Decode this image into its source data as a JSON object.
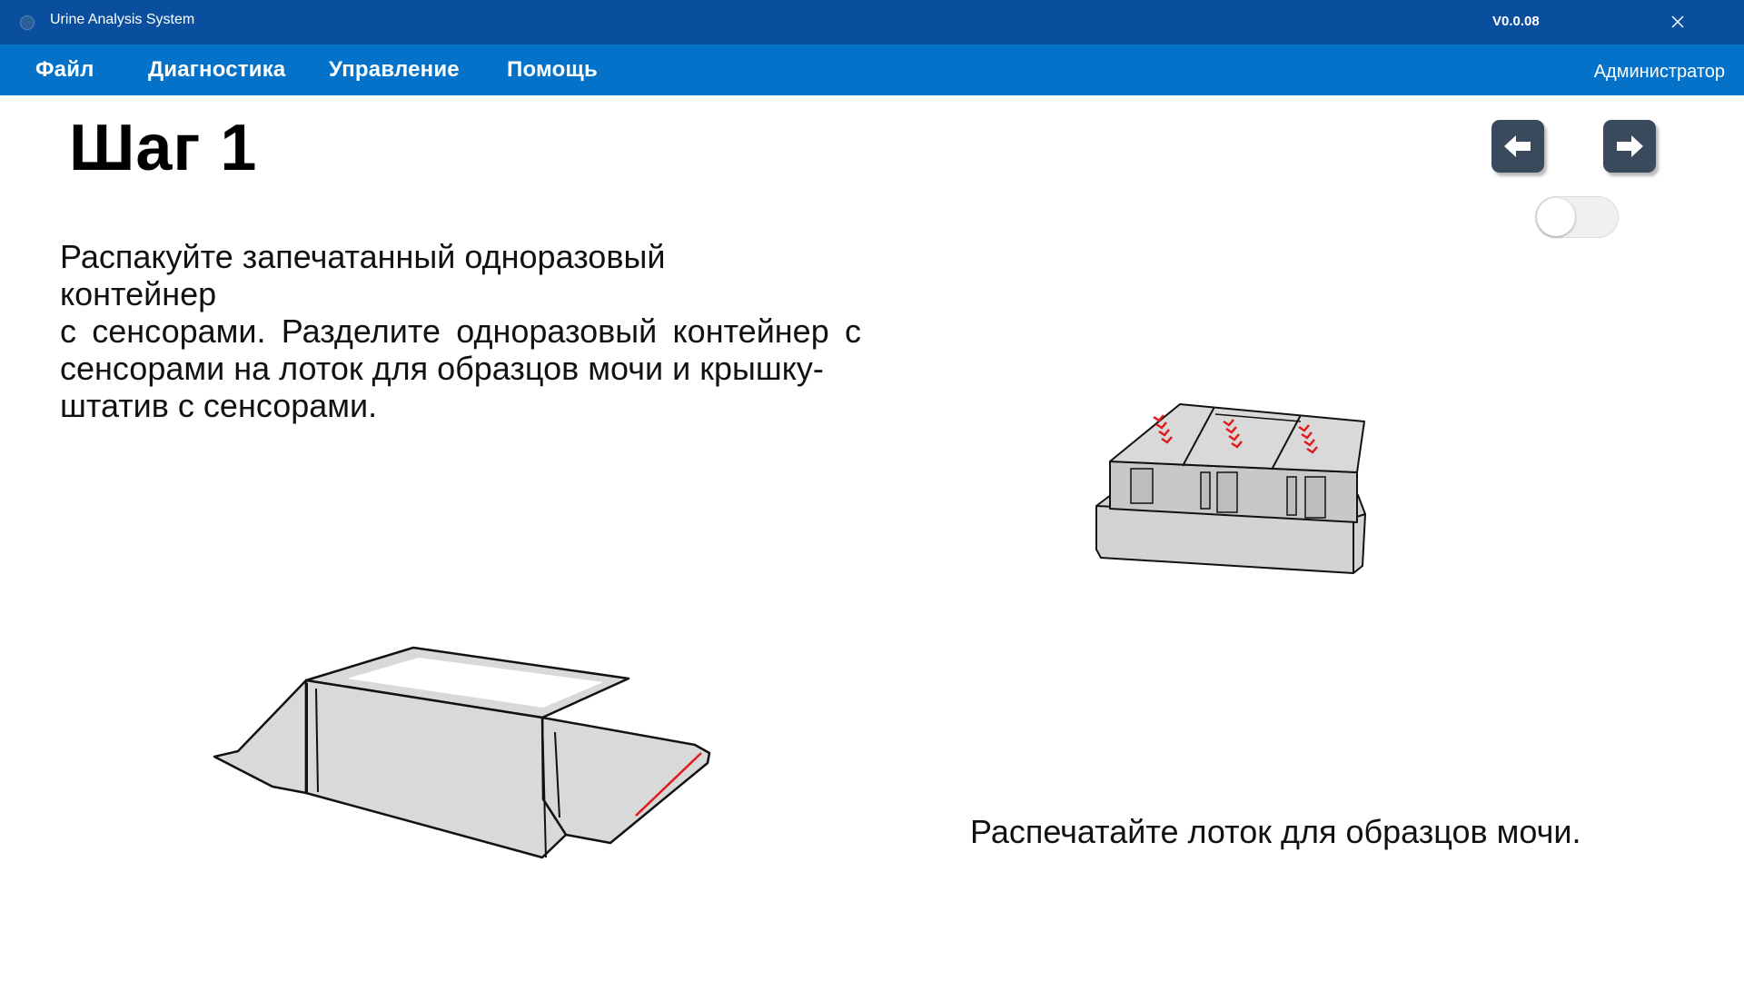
{
  "titlebar": {
    "app_title": "Urine Analysis System",
    "version": "V0.0.08",
    "icons": {
      "app": "app-icon",
      "close": "close-icon"
    }
  },
  "menu": {
    "items": [
      {
        "label": "Файл"
      },
      {
        "label": "Диагностика"
      },
      {
        "label": "Управление"
      },
      {
        "label": "Помощь"
      }
    ],
    "user": "Администратор"
  },
  "step": {
    "title": "Шаг 1",
    "instruction_lines": [
      "Распакуйте запечатанный одноразовый",
      "контейнер",
      "с сенсорами. Разделите одноразовый контейнер с",
      "сенсорами на лоток для образцов мочи и крышку-",
      "штатив с сенсорами."
    ],
    "caption": "Распечатайте лоток для образцов мочи."
  },
  "nav": {
    "prev_icon": "arrow-left-icon",
    "next_icon": "arrow-right-icon"
  },
  "toggle": {
    "on": false
  },
  "colors": {
    "titlebar": "#0a4f9e",
    "menubar": "#0572c9",
    "nav_button": "#384a5c",
    "illustration_fill": "#d9d9d9",
    "tear_mark": "#e01b1b"
  }
}
